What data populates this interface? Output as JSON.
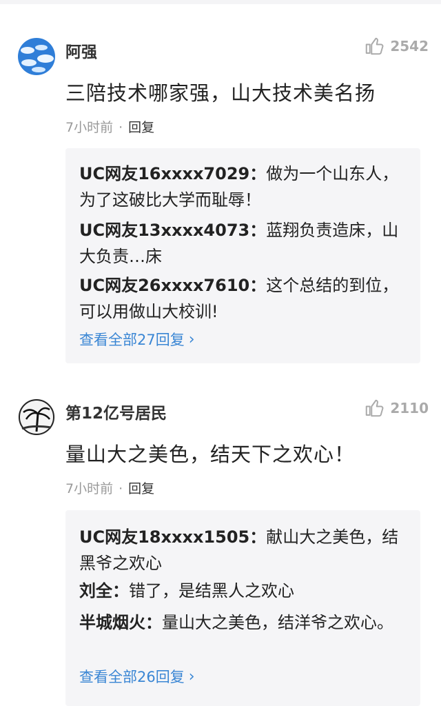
{
  "comments": [
    {
      "username": "阿强",
      "likes": "2542",
      "content": "三陪技术哪家强，山大技术美名扬",
      "time": "7小时前",
      "reply_label": "回复",
      "replies": [
        {
          "name": "UC网友16xxxx7029：",
          "text": "做为一个山东人，为了这破比大学而耻辱！"
        },
        {
          "name": "UC网友13xxxx4073：",
          "text": "蓝翔负责造床，山大负责…床"
        },
        {
          "name": "UC网友26xxxx7610：",
          "text": "这个总结的到位，可以用做山大校训!"
        }
      ],
      "view_all": "查看全部27回复"
    },
    {
      "username": "第12亿号居民",
      "likes": "2110",
      "content": "量山大之美色，结天下之欢心！",
      "time": "7小时前",
      "reply_label": "回复",
      "replies": [
        {
          "name": "UC网友18xxxx1505：",
          "text": "献山大之美色，结黑爷之欢心"
        },
        {
          "name": "刘全：",
          "text": "错了，是结黑人之欢心"
        },
        {
          "name": "半城烟火：",
          "text": "量山大之美色，结洋爷之欢心。"
        }
      ],
      "view_all": "查看全部26回复"
    }
  ],
  "icons": {
    "like": "thumbs-up-icon",
    "chevron": "chevron-right-icon"
  },
  "colors": {
    "link": "#3a86d4",
    "reply_bg": "#f5f5f7",
    "meta": "#999999"
  }
}
